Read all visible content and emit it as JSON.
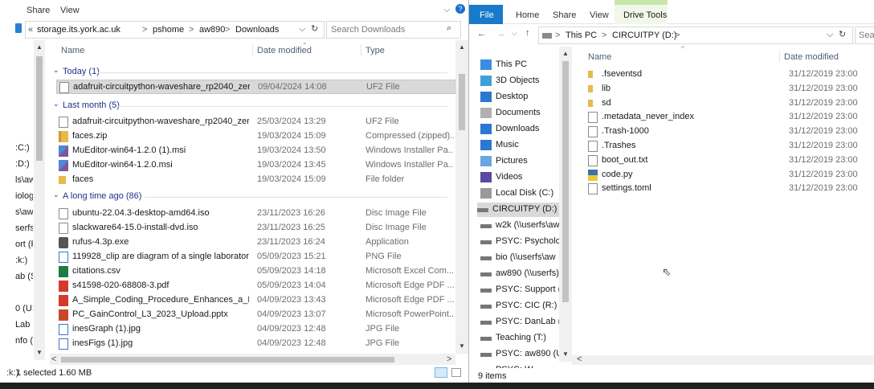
{
  "left": {
    "ribbon_tabs": [
      "Share",
      "View"
    ],
    "breadcrumb": [
      "«",
      "storage.its.york.ac.uk",
      ">",
      "pshome",
      ">",
      "aw890",
      ">",
      "Downloads"
    ],
    "search_placeholder": "Search Downloads",
    "columns": {
      "name": "Name",
      "date": "Date modified",
      "type": "Type"
    },
    "nav_items": [
      ":C:)",
      ":D:)",
      "ls\\aw",
      "iolog",
      "s\\aw(",
      "serfs)",
      "ort (F",
      ":k:)",
      "ab (S:",
      "0 (U:)",
      "Lab (",
      "nfo (\\",
      ":k:)"
    ],
    "groups": [
      {
        "label": "Today (1)",
        "rows": [
          {
            "name": "adafruit-circuitpython-waveshare_rp2040_zero-...",
            "date": "09/04/2024 14:08",
            "type": "UF2 File",
            "icon": "doc-icon",
            "selected": true
          }
        ]
      },
      {
        "label": "Last month (5)",
        "rows": [
          {
            "name": "adafruit-circuitpython-waveshare_rp2040_zero-...",
            "date": "25/03/2024 13:29",
            "type": "UF2 File",
            "icon": "doc-icon"
          },
          {
            "name": "faces.zip",
            "date": "19/03/2024 15:09",
            "type": "Compressed (zipped)...",
            "icon": "zip-icon"
          },
          {
            "name": "MuEditor-win64-1.2.0 (1).msi",
            "date": "19/03/2024 13:50",
            "type": "Windows Installer Pa...",
            "icon": "msi-icon"
          },
          {
            "name": "MuEditor-win64-1.2.0.msi",
            "date": "19/03/2024 13:45",
            "type": "Windows Installer Pa...",
            "icon": "msi-icon"
          },
          {
            "name": "faces",
            "date": "19/03/2024 15:09",
            "type": "File folder",
            "icon": "folder-icon"
          }
        ]
      },
      {
        "label": "A long time ago (86)",
        "rows": [
          {
            "name": "ubuntu-22.04.3-desktop-amd64.iso",
            "date": "23/11/2023 16:26",
            "type": "Disc Image File",
            "icon": "iso-icon"
          },
          {
            "name": "slackware64-15.0-install-dvd.iso",
            "date": "23/11/2023 16:25",
            "type": "Disc Image File",
            "icon": "iso-icon"
          },
          {
            "name": "rufus-4.3p.exe",
            "date": "23/11/2023 16:24",
            "type": "Application",
            "icon": "exe-icon"
          },
          {
            "name": "119928_clip are diagram of a single laboratory ...",
            "date": "05/09/2023 15:21",
            "type": "PNG File",
            "icon": "image-icon"
          },
          {
            "name": "citations.csv",
            "date": "05/09/2023 14:18",
            "type": "Microsoft Excel Com...",
            "icon": "excel-icon"
          },
          {
            "name": "s41598-020-68808-3.pdf",
            "date": "05/09/2023 14:04",
            "type": "Microsoft Edge PDF ...",
            "icon": "pdf-icon"
          },
          {
            "name": "A_Simple_Coding_Procedure_Enhances_a_Neuro...",
            "date": "04/09/2023 13:43",
            "type": "Microsoft Edge PDF ...",
            "icon": "pdf-icon"
          },
          {
            "name": "PC_GainControl_L3_2023_Upload.pptx",
            "date": "04/09/2023 13:07",
            "type": "Microsoft PowerPoint...",
            "icon": "ppt-icon"
          },
          {
            "name": "inesGraph (1).jpg",
            "date": "04/09/2023 12:48",
            "type": "JPG File",
            "icon": "image-icon"
          },
          {
            "name": "inesFigs (1).jpg",
            "date": "04/09/2023 12:48",
            "type": "JPG File",
            "icon": "image-icon"
          }
        ]
      }
    ],
    "status": "1 selected  1.60 MB"
  },
  "right": {
    "ribbon_tabs": [
      "File",
      "Home",
      "Share",
      "View",
      "Drive Tools"
    ],
    "manage_label": "Manage",
    "breadcrumb": [
      "This PC",
      ">",
      "CIRCUITPY (D:)",
      ">"
    ],
    "search_placeholder": "Sear",
    "columns": {
      "name": "Name",
      "date": "Date modified"
    },
    "nav_items": [
      {
        "label": "This PC",
        "icon": "pc-icon"
      },
      {
        "label": "3D Objects",
        "icon": "cube-icon"
      },
      {
        "label": "Desktop",
        "icon": "desktop-icon"
      },
      {
        "label": "Documents",
        "icon": "documents-icon"
      },
      {
        "label": "Downloads",
        "icon": "download-icon"
      },
      {
        "label": "Music",
        "icon": "music-icon"
      },
      {
        "label": "Pictures",
        "icon": "pictures-icon"
      },
      {
        "label": "Videos",
        "icon": "videos-icon"
      },
      {
        "label": "Local Disk (C:)",
        "icon": "disk-icon"
      },
      {
        "label": "CIRCUITPY (D:)",
        "icon": "drive-icon",
        "selected": true
      },
      {
        "label": "w2k (\\\\userfs\\aw",
        "icon": "netdrive-icon"
      },
      {
        "label": "PSYC: Psycholog",
        "icon": "netdrive-icon"
      },
      {
        "label": "bio (\\\\userfs\\aw",
        "icon": "netdrive-icon"
      },
      {
        "label": "aw890 (\\\\userfs)",
        "icon": "netdrive-icon"
      },
      {
        "label": "PSYC: Support (F",
        "icon": "netdrive-icon"
      },
      {
        "label": "PSYC: CIC (R:)",
        "icon": "netdrive-icon"
      },
      {
        "label": "PSYC: DanLab (S:",
        "icon": "netdrive-icon"
      },
      {
        "label": "Teaching (T:)",
        "icon": "netdrive-icon"
      },
      {
        "label": "PSYC: aw890 (U:)",
        "icon": "netdrive-icon"
      },
      {
        "label": "PSYC: W...",
        "icon": "netdrive-icon"
      }
    ],
    "rows": [
      {
        "name": ".fseventsd",
        "date": "31/12/2019 23:00",
        "icon": "folder-icon"
      },
      {
        "name": "lib",
        "date": "31/12/2019 23:00",
        "icon": "folder-icon"
      },
      {
        "name": "sd",
        "date": "31/12/2019 23:00",
        "icon": "folder-icon"
      },
      {
        "name": ".metadata_never_index",
        "date": "31/12/2019 23:00",
        "icon": "doc-icon"
      },
      {
        "name": ".Trash-1000",
        "date": "31/12/2019 23:00",
        "icon": "doc-icon"
      },
      {
        "name": ".Trashes",
        "date": "31/12/2019 23:00",
        "icon": "doc-icon"
      },
      {
        "name": "boot_out.txt",
        "date": "31/12/2019 23:00",
        "icon": "txt-icon"
      },
      {
        "name": "code.py",
        "date": "31/12/2019 23:00",
        "icon": "python-icon"
      },
      {
        "name": "settings.toml",
        "date": "31/12/2019 23:00",
        "icon": "doc-icon"
      }
    ],
    "status": "9 items"
  },
  "colors": {
    "accent": "#1979ca",
    "selection": "#cce8ff",
    "manage": "#c9e6a9"
  }
}
